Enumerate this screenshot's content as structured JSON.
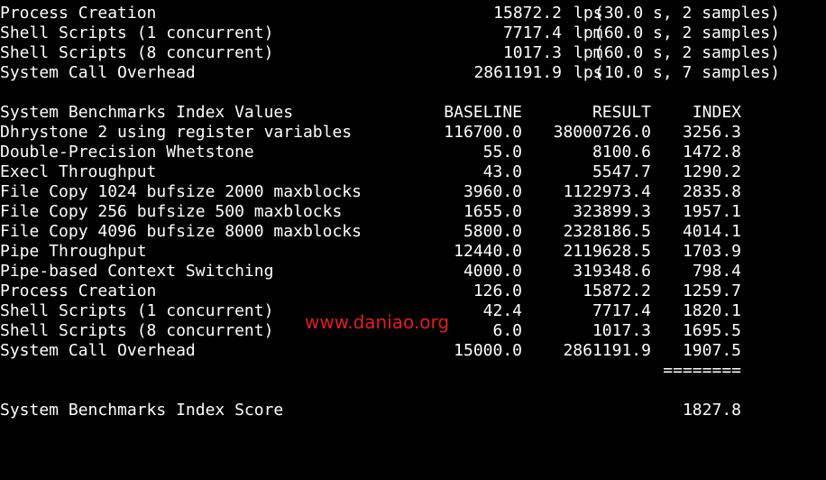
{
  "summary_rows": [
    {
      "name": "Process Creation",
      "value": "15872.2",
      "unit": "lps",
      "info": "(30.0 s, 2 samples)"
    },
    {
      "name": "Shell Scripts (1 concurrent)",
      "value": "7717.4",
      "unit": "lpm",
      "info": "(60.0 s, 2 samples)"
    },
    {
      "name": "Shell Scripts (8 concurrent)",
      "value": "1017.3",
      "unit": "lpm",
      "info": "(60.0 s, 2 samples)"
    },
    {
      "name": "System Call Overhead",
      "value": "2861191.9",
      "unit": "lps",
      "info": "(10.0 s, 7 samples)"
    }
  ],
  "index_table": {
    "title": "System Benchmarks Index Values",
    "columns": [
      "BASELINE",
      "RESULT",
      "INDEX"
    ],
    "rows": [
      {
        "name": "Dhrystone 2 using register variables",
        "baseline": "116700.0",
        "result": "38000726.0",
        "index": "3256.3"
      },
      {
        "name": "Double-Precision Whetstone",
        "baseline": "55.0",
        "result": "8100.6",
        "index": "1472.8"
      },
      {
        "name": "Execl Throughput",
        "baseline": "43.0",
        "result": "5547.7",
        "index": "1290.2"
      },
      {
        "name": "File Copy 1024 bufsize 2000 maxblocks",
        "baseline": "3960.0",
        "result": "1122973.4",
        "index": "2835.8"
      },
      {
        "name": "File Copy 256 bufsize 500 maxblocks",
        "baseline": "1655.0",
        "result": "323899.3",
        "index": "1957.1"
      },
      {
        "name": "File Copy 4096 bufsize 8000 maxblocks",
        "baseline": "5800.0",
        "result": "2328186.5",
        "index": "4014.1"
      },
      {
        "name": "Pipe Throughput",
        "baseline": "12440.0",
        "result": "2119628.5",
        "index": "1703.9"
      },
      {
        "name": "Pipe-based Context Switching",
        "baseline": "4000.0",
        "result": "319348.6",
        "index": "798.4"
      },
      {
        "name": "Process Creation",
        "baseline": "126.0",
        "result": "15872.2",
        "index": "1259.7"
      },
      {
        "name": "Shell Scripts (1 concurrent)",
        "baseline": "42.4",
        "result": "7717.4",
        "index": "1820.1"
      },
      {
        "name": "Shell Scripts (8 concurrent)",
        "baseline": "6.0",
        "result": "1017.3",
        "index": "1695.5"
      },
      {
        "name": "System Call Overhead",
        "baseline": "15000.0",
        "result": "2861191.9",
        "index": "1907.5"
      }
    ],
    "separator": "========",
    "score_label": "System Benchmarks Index Score",
    "score_value": "1827.8"
  },
  "watermark": "www.daniao.org",
  "colors": {
    "background": "#000000",
    "text": "#ffffff",
    "watermark": "#e31c1c"
  }
}
